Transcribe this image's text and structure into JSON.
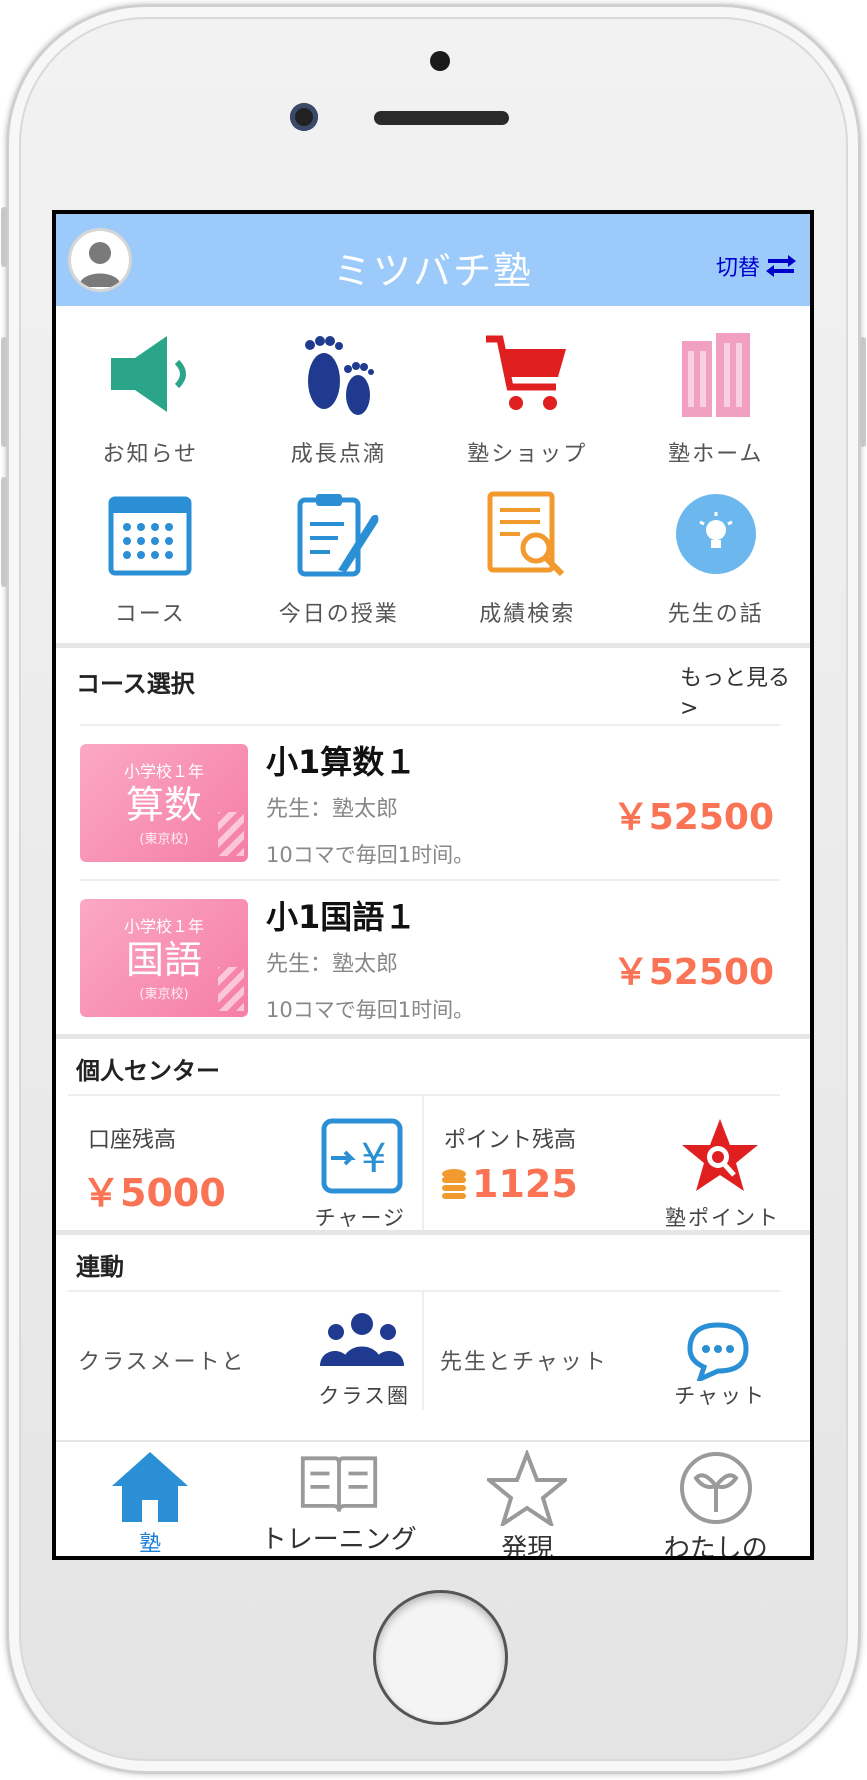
{
  "header": {
    "title": "ミツバチ塾",
    "switch_label": "切替"
  },
  "menu": [
    {
      "label": "お知らせ",
      "icon": "speaker-icon"
    },
    {
      "label": "成長点滴",
      "icon": "footprints-icon"
    },
    {
      "label": "塾ショップ",
      "icon": "cart-icon"
    },
    {
      "label": "塾ホーム",
      "icon": "building-icon"
    },
    {
      "label": "コース",
      "icon": "calendar-icon"
    },
    {
      "label": "今日の授業",
      "icon": "clipboard-pen-icon"
    },
    {
      "label": "成績検索",
      "icon": "document-search-icon"
    },
    {
      "label": "先生の話",
      "icon": "lightbulb-icon"
    }
  ],
  "courses_section": {
    "title": "コース選択",
    "more": "もっと見る >",
    "items": [
      {
        "thumb_top": "小学校１年",
        "thumb_main": "算数",
        "thumb_sub": "(東京校)",
        "name": "小1算数１",
        "teacher": "先生：塾太郎",
        "desc": "10コマで毎回1时间。",
        "price": "￥52500"
      },
      {
        "thumb_top": "小学校１年",
        "thumb_main": "国語",
        "thumb_sub": "(東京校)",
        "name": "小1国語１",
        "teacher": "先生：塾太郎",
        "desc": "10コマで毎回1时间。",
        "price": "￥52500"
      }
    ]
  },
  "personal_section": {
    "title": "個人センター",
    "balance_label": "口座残高",
    "balance_value": "￥5000",
    "charge_label": "チャージ",
    "points_label": "ポイント残高",
    "points_value": "1125",
    "juku_points_label": "塾ポイント"
  },
  "activity_section": {
    "title": "連動",
    "classmates_label": "クラスメートと",
    "class_circle_label": "クラス圏",
    "teacher_chat_label": "先生とチャット",
    "chat_label": "チャット"
  },
  "tabbar": [
    {
      "label": "塾",
      "icon": "home-icon",
      "active": true
    },
    {
      "label": "トレーニング",
      "icon": "book-icon",
      "active": false
    },
    {
      "label": "発現",
      "icon": "star-icon",
      "active": false
    },
    {
      "label": "わたしの",
      "icon": "sprout-icon",
      "active": false
    }
  ],
  "colors": {
    "header_bg": "#9ccbfb",
    "price": "#fa7355",
    "tab_active": "#1a7fd6"
  }
}
